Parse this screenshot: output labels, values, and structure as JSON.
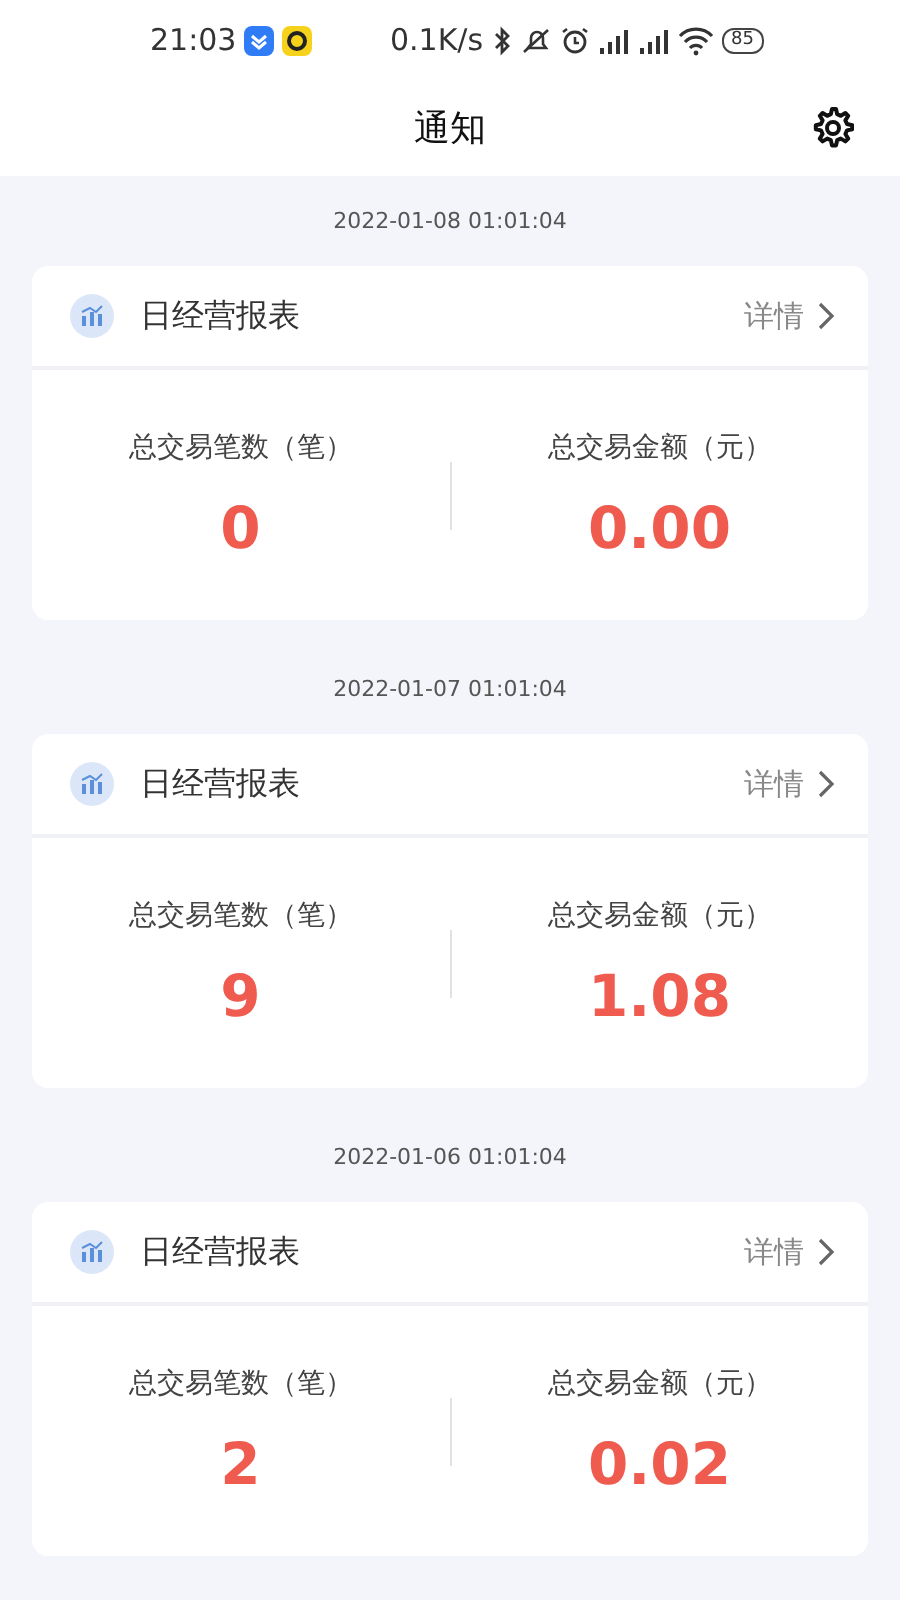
{
  "status_bar": {
    "time": "21:03",
    "net_speed": "0.1K/s",
    "battery": "85"
  },
  "header": {
    "title": "通知"
  },
  "notifications": [
    {
      "date": "2022-01-08 01:01:04",
      "title": "日经营报表",
      "link": "详情",
      "stats": [
        {
          "label": "总交易笔数（笔）",
          "value": "0"
        },
        {
          "label": "总交易金额（元）",
          "value": "0.00"
        }
      ]
    },
    {
      "date": "2022-01-07 01:01:04",
      "title": "日经营报表",
      "link": "详情",
      "stats": [
        {
          "label": "总交易笔数（笔）",
          "value": "9"
        },
        {
          "label": "总交易金额（元）",
          "value": "1.08"
        }
      ]
    },
    {
      "date": "2022-01-06 01:01:04",
      "title": "日经营报表",
      "link": "详情",
      "stats": [
        {
          "label": "总交易笔数（笔）",
          "value": "2"
        },
        {
          "label": "总交易金额（元）",
          "value": "0.02"
        }
      ]
    }
  ]
}
